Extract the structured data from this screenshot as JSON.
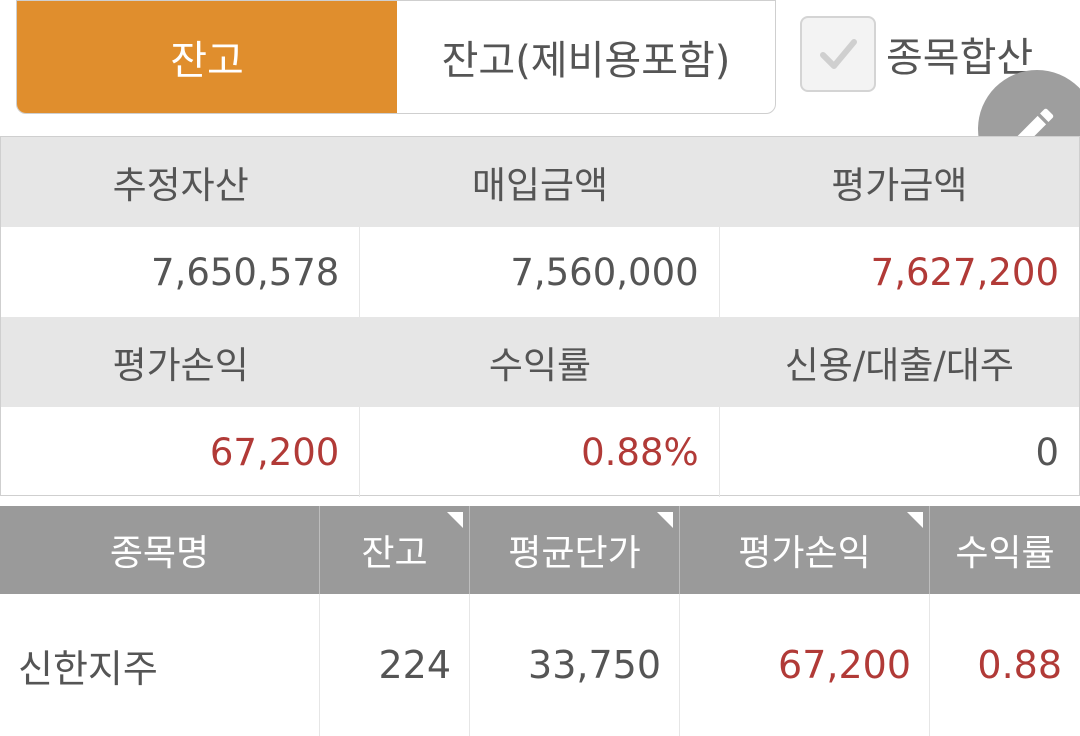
{
  "toggle": {
    "balance_label": "잔고",
    "balance_with_fees_label": "잔고(제비용포함)"
  },
  "combine": {
    "label": "종목합산",
    "checked": true
  },
  "edit_button": {
    "icon": "pencil-icon"
  },
  "summary": {
    "estimated_assets_label": "추정자산",
    "estimated_assets_value": "7,650,578",
    "purchase_amount_label": "매입금액",
    "purchase_amount_value": "7,560,000",
    "valuation_amount_label": "평가금액",
    "valuation_amount_value": "7,627,200",
    "valuation_pl_label": "평가손익",
    "valuation_pl_value": "67,200",
    "return_rate_label": "수익률",
    "return_rate_value": "0.88%",
    "credit_loan_label": "신용/대출/대주",
    "credit_loan_value": "0"
  },
  "holdings": {
    "columns": {
      "name": "종목명",
      "quantity": "잔고",
      "avg_price": "평균단가",
      "pl": "평가손익",
      "return": "수익률"
    },
    "rows": [
      {
        "name": "신한지주",
        "quantity": "224",
        "avg_price": "33,750",
        "pl": "67,200",
        "return": "0.88"
      }
    ]
  },
  "colors": {
    "accent": "#e08e2d",
    "positive": "#b13a37",
    "header_gray": "#9a9a9a",
    "summary_header": "#e6e6e6"
  }
}
